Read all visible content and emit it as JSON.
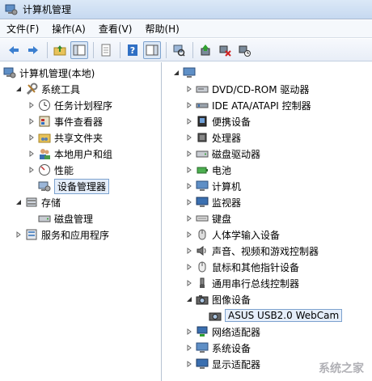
{
  "window": {
    "title": "计算机管理"
  },
  "menu": [
    "文件(F)",
    "操作(A)",
    "查看(V)",
    "帮助(H)"
  ],
  "left_tree": {
    "root": "计算机管理(本地)",
    "system_tools": "系统工具",
    "system_items": [
      "任务计划程序",
      "事件查看器",
      "共享文件夹",
      "本地用户和组",
      "性能",
      "设备管理器"
    ],
    "storage": "存储",
    "storage_items": [
      "磁盘管理"
    ],
    "services": "服务和应用程序"
  },
  "right_tree": {
    "root": "",
    "categories": [
      "DVD/CD-ROM 驱动器",
      "IDE ATA/ATAPI 控制器",
      "便携设备",
      "处理器",
      "磁盘驱动器",
      "电池",
      "计算机",
      "监视器",
      "键盘",
      "人体学输入设备",
      "声音、视频和游戏控制器",
      "鼠标和其他指针设备",
      "通用串行总线控制器",
      "图像设备"
    ],
    "image_device_child": "ASUS USB2.0 WebCam",
    "after_categories": [
      "网络适配器",
      "系统设备",
      "显示适配器"
    ]
  },
  "watermark": "系统之家"
}
